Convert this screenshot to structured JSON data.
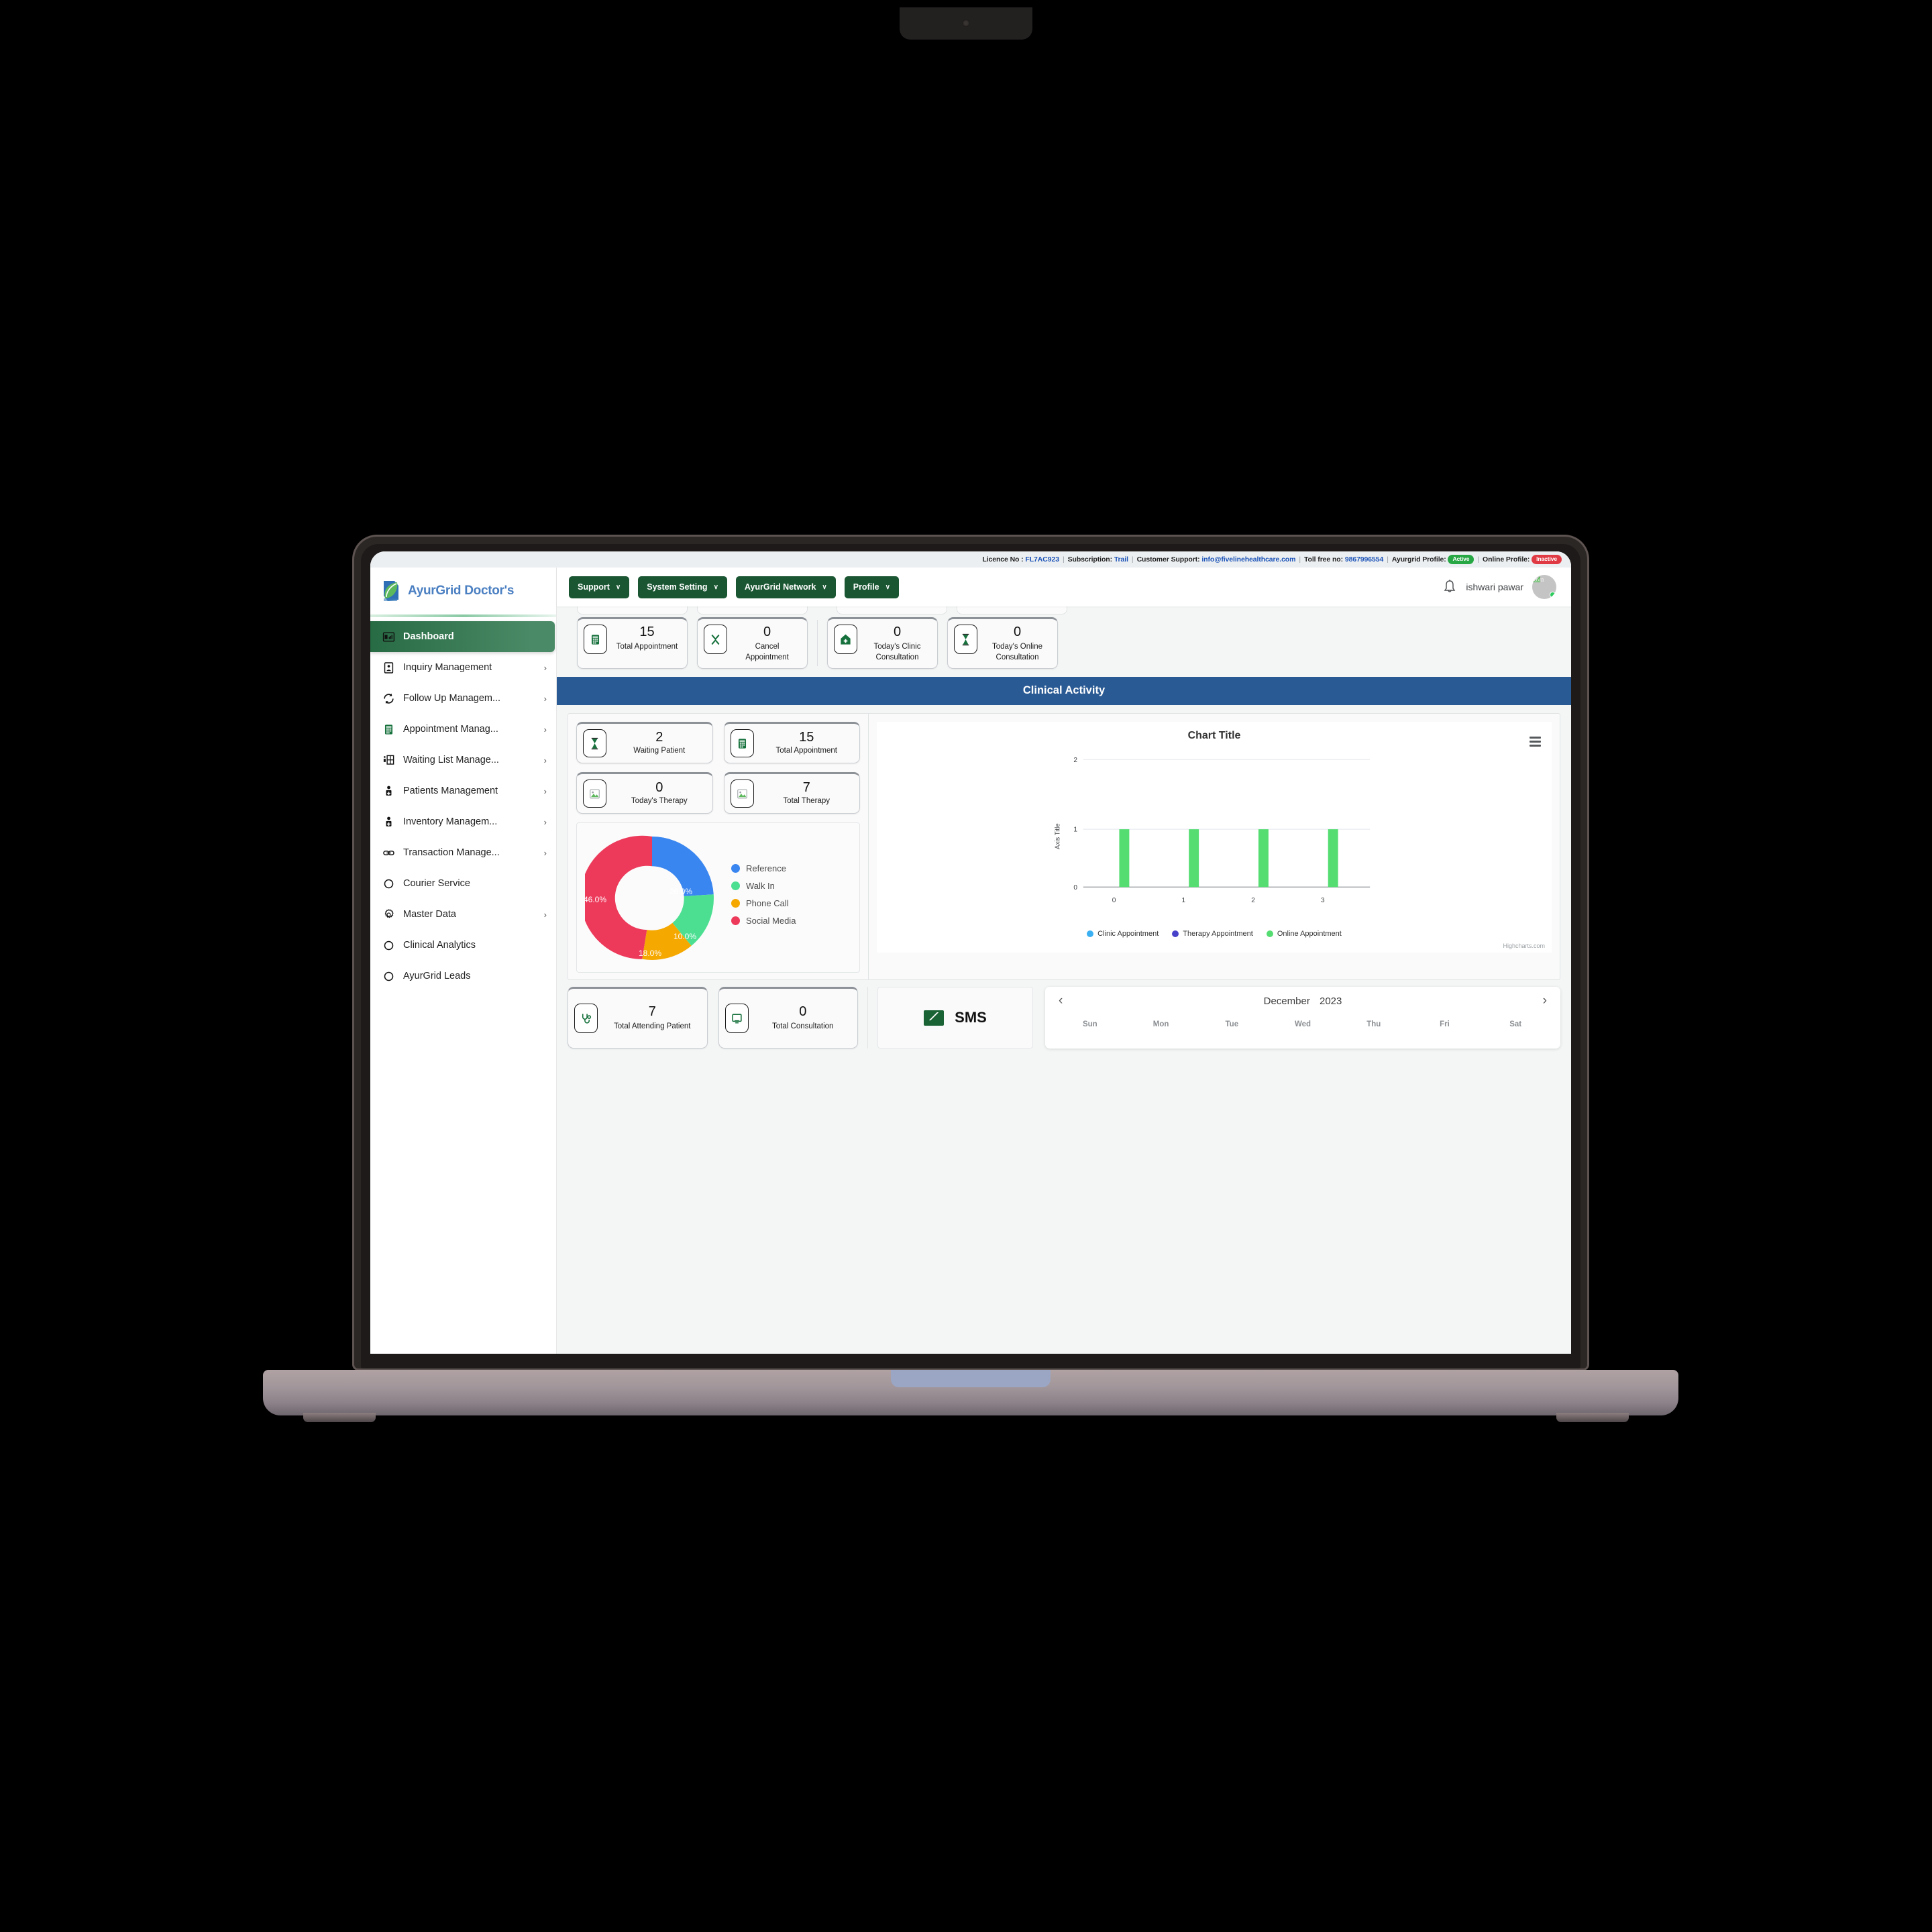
{
  "licence_bar": {
    "licence_label": "Licence No :",
    "licence_value": "FL7AC923",
    "subscription_label": "Subscription:",
    "subscription_value": "Trail",
    "support_label": "Customer Support:",
    "support_email": "info@fivelinehealthcare.com",
    "tollfree_label": "Toll free no:",
    "tollfree_value": "9867996554",
    "ayurgrid_profile_label": "Ayurgrid Profile:",
    "ayurgrid_profile_status": "Active",
    "online_profile_label": "Online Profile:",
    "online_profile_status": "Inactive"
  },
  "sidebar": {
    "brand": "AyurGrid Doctor's",
    "items": [
      {
        "label": "Dashboard",
        "icon": "dashboard-icon",
        "chevron": false,
        "active": true
      },
      {
        "label": "Inquiry Management",
        "icon": "inquiry-icon",
        "chevron": true,
        "active": false
      },
      {
        "label": "Follow Up Managem...",
        "icon": "refresh-icon",
        "chevron": true,
        "active": false
      },
      {
        "label": "Appointment Manag...",
        "icon": "calendar-icon",
        "chevron": true,
        "active": false
      },
      {
        "label": "Waiting List Manage...",
        "icon": "waiting-list-icon",
        "chevron": true,
        "active": false
      },
      {
        "label": "Patients Management",
        "icon": "patient-icon",
        "chevron": true,
        "active": false
      },
      {
        "label": "Inventory Managem...",
        "icon": "inventory-icon",
        "chevron": true,
        "active": false
      },
      {
        "label": "Transaction Manage...",
        "icon": "link-icon",
        "chevron": true,
        "active": false
      },
      {
        "label": "Courier Service",
        "icon": "circle-icon",
        "chevron": false,
        "active": false
      },
      {
        "label": "Master Data",
        "icon": "gear-icon",
        "chevron": true,
        "active": false
      },
      {
        "label": "Clinical Analytics",
        "icon": "circle-icon",
        "chevron": false,
        "active": false
      },
      {
        "label": "AyurGrid Leads",
        "icon": "circle-icon",
        "chevron": false,
        "active": false
      }
    ]
  },
  "topbar": {
    "buttons": [
      {
        "label": "Support",
        "caret": "∨"
      },
      {
        "label": "System Setting",
        "caret": "∨"
      },
      {
        "label": "AyurGrid Network",
        "caret": "∨"
      },
      {
        "label": "Profile",
        "caret": "∨"
      }
    ],
    "notification_icon": "bell-icon",
    "user_name": "ishwari pawar",
    "avatar_alt": "ava"
  },
  "appointment_strip": {
    "left_cards": [
      {
        "value": "15",
        "label": "Total Appointment",
        "icon": "calendar-icon"
      },
      {
        "value": "0",
        "label": "Cancel Appointment",
        "icon": "cross-icon"
      }
    ],
    "right_cards": [
      {
        "value": "0",
        "label": "Today's Clinic Consultation",
        "icon": "clinic-icon"
      },
      {
        "value": "0",
        "label": "Today's Online Consultation",
        "icon": "hourglass-icon"
      }
    ]
  },
  "clinical_activity": {
    "title": "Clinical Activity",
    "cards": [
      {
        "value": "2",
        "label": "Waiting Patient",
        "icon": "hourglass-icon"
      },
      {
        "value": "15",
        "label": "Total Appointment",
        "icon": "calendar-icon"
      },
      {
        "value": "0",
        "label": "Today's Therapy",
        "icon": "broken-image-icon"
      },
      {
        "value": "7",
        "label": "Total Therapy",
        "icon": "broken-image-icon"
      }
    ]
  },
  "bottom_cards": [
    {
      "value": "7",
      "label": "Total Attending Patient",
      "icon": "stethoscope-icon"
    },
    {
      "value": "0",
      "label": "Total Consultation",
      "icon": "monitor-icon"
    }
  ],
  "sms": {
    "label": "SMS",
    "icon": "envelope-icon"
  },
  "calendar": {
    "prev_icon": "chevron-left-icon",
    "next_icon": "chevron-right-icon",
    "month": "December",
    "year": "2023",
    "dows": [
      "Sun",
      "Mon",
      "Tue",
      "Wed",
      "Thu",
      "Fri",
      "Sat"
    ]
  },
  "chart_data": [
    {
      "type": "pie",
      "variant": "donut",
      "title": "",
      "labels": [
        "Reference",
        "Walk In",
        "Phone Call",
        "Social Media"
      ],
      "values": [
        26.0,
        10.0,
        18.0,
        46.0
      ],
      "value_labels": [
        "26.0%",
        "10.0%",
        "18.0%",
        "46.0%"
      ],
      "colors": [
        "#3a86f0",
        "#4cdf92",
        "#f5a800",
        "#ed3a5b"
      ],
      "legend_position": "right",
      "unit": "%"
    },
    {
      "type": "bar",
      "title": "Chart Title",
      "xlabel": "",
      "ylabel": "Axis Title",
      "categories": [
        "0",
        "1",
        "2",
        "3"
      ],
      "ytick_labels": [
        "0",
        "1",
        "2"
      ],
      "ylim": [
        0,
        2
      ],
      "grid": true,
      "credit": "Highcharts.com",
      "menu_icon": "hamburger-menu-icon",
      "series": [
        {
          "name": "Clinic Appointment",
          "color": "#3ab0f2",
          "values": [
            0,
            0,
            0,
            0
          ]
        },
        {
          "name": "Therapy Appointment",
          "color": "#4841c9",
          "values": [
            0,
            0,
            0,
            0
          ]
        },
        {
          "name": "Online Appointment",
          "color": "#55dd72",
          "values": [
            1,
            1,
            1,
            1
          ]
        }
      ],
      "legend_position": "bottom"
    }
  ]
}
